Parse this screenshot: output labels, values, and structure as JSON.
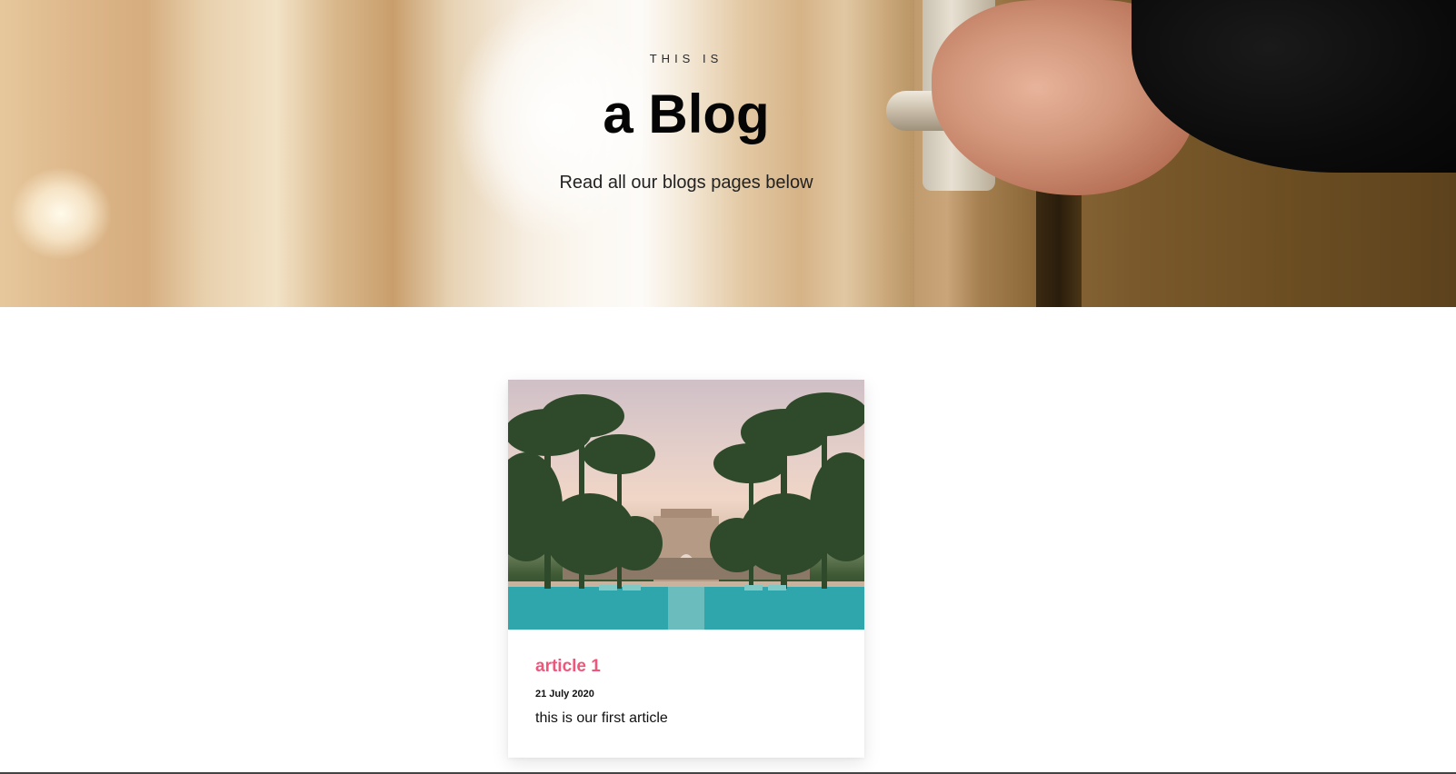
{
  "hero": {
    "eyebrow": "THIS IS",
    "title": "a Blog",
    "subtitle": "Read all our blogs pages below"
  },
  "articles": [
    {
      "title": "article 1",
      "date": "21 July 2020",
      "excerpt": "this is our first article"
    }
  ],
  "colors": {
    "article_title": "#f0557a",
    "text": "#111111",
    "background": "#ffffff"
  }
}
